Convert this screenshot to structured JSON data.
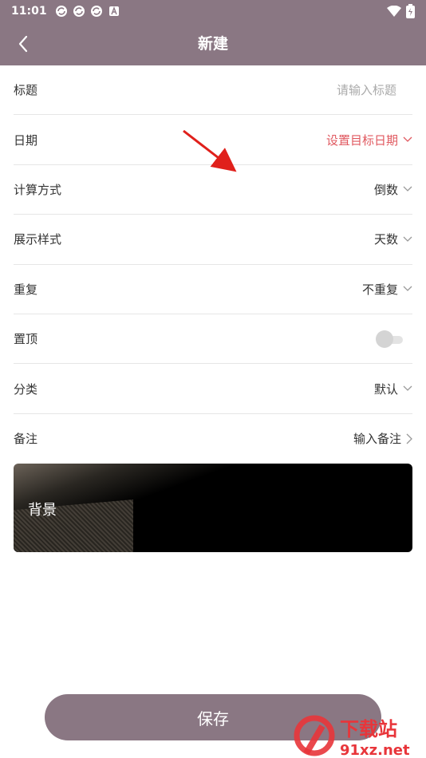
{
  "status_bar": {
    "time": "11:01"
  },
  "header": {
    "title": "新建"
  },
  "form": {
    "title_label": "标题",
    "title_placeholder": "请输入标题",
    "date_label": "日期",
    "date_value": "设置目标日期",
    "calc_label": "计算方式",
    "calc_value": "倒数",
    "display_label": "展示样式",
    "display_value": "天数",
    "repeat_label": "重复",
    "repeat_value": "不重复",
    "pin_label": "置顶",
    "pin_on": false,
    "category_label": "分类",
    "category_value": "默认",
    "note_label": "备注",
    "note_value": "输入备注"
  },
  "background": {
    "label": "背景"
  },
  "save_label": "保存",
  "watermark": {
    "big": "下载站",
    "small": "91xz.net"
  },
  "colors": {
    "header": "#8a7783",
    "accent": "#e0585f"
  }
}
